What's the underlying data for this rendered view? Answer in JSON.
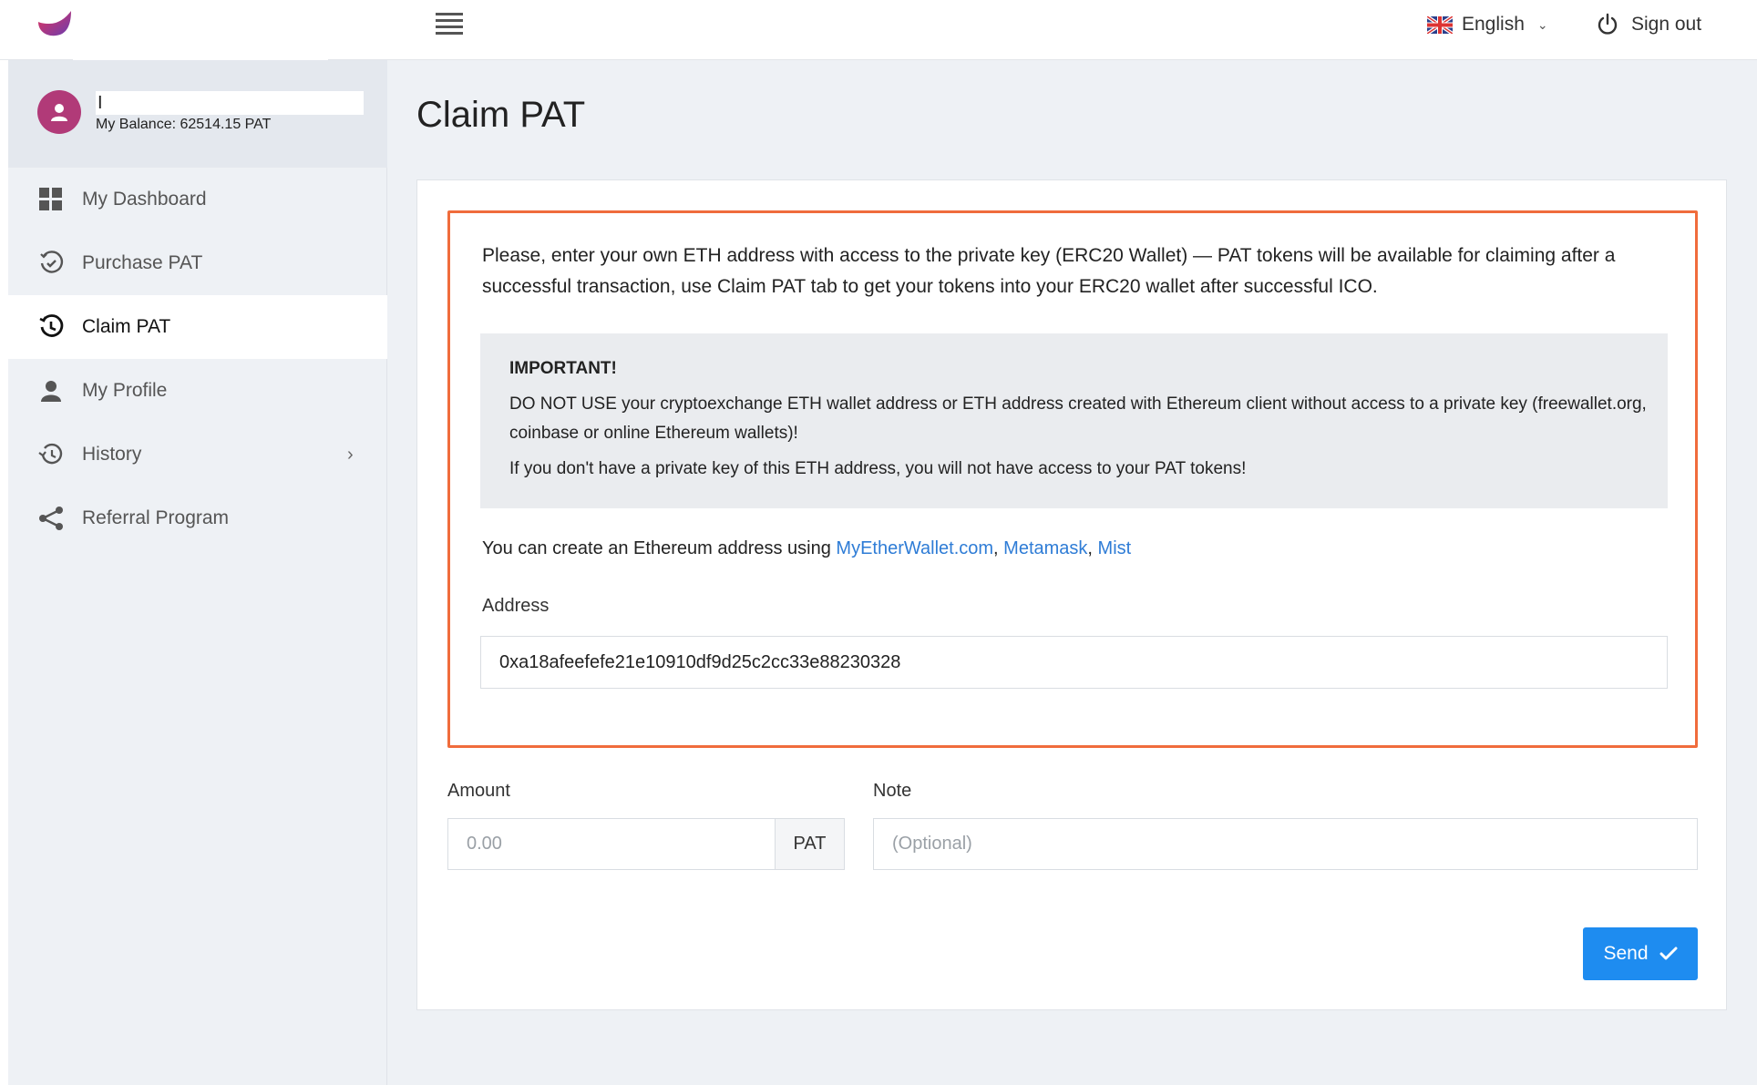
{
  "header": {
    "language_label": "English",
    "signout_label": "Sign out"
  },
  "sidebar": {
    "user_initial": "I",
    "balance": "My Balance: 62514.15 PAT",
    "items": [
      {
        "label": "My Dashboard",
        "icon": "dashboard-grid-icon"
      },
      {
        "label": "Purchase PAT",
        "icon": "purchase-clock-icon"
      },
      {
        "label": "Claim PAT",
        "icon": "claim-history-icon",
        "active": true
      },
      {
        "label": "My Profile",
        "icon": "user-icon"
      },
      {
        "label": "History",
        "icon": "history-icon",
        "has_submenu": true
      },
      {
        "label": "Referral Program",
        "icon": "share-icon"
      }
    ]
  },
  "main": {
    "title": "Claim PAT",
    "notice": {
      "text": "Please, enter your own ETH address with access to the private key (ERC20 Wallet) — PAT tokens will be available for claiming after a successful transaction, use Claim PAT tab to get your tokens into your ERC20 wallet after successful ICO.",
      "important_title": "IMPORTANT!",
      "important_line1": "DO NOT USE your cryptoexchange ETH wallet address or ETH address created with Ethereum client without access to a private key (freewallet.org, coinbase or online Ethereum wallets)!",
      "important_line2": "If you don't have a private key of this ETH address, you will not have access to your PAT tokens!",
      "create_prefix": "You can create an Ethereum address using ",
      "link1": "MyEtherWallet.com",
      "sep1": ", ",
      "link2": "Metamask",
      "sep2": ", ",
      "link3": "Mist"
    },
    "address": {
      "label": "Address",
      "value": "0xa18afeefefe21e10910df9d25c2cc33e88230328"
    },
    "amount": {
      "label": "Amount",
      "placeholder": "0.00",
      "unit": "PAT"
    },
    "note": {
      "label": "Note",
      "placeholder": "(Optional)"
    },
    "send_label": "Send"
  },
  "colors": {
    "accent": "#1e8cf0",
    "notice_border": "#f06c3c",
    "link": "#2e7cd6",
    "avatar": "#b13a78"
  }
}
